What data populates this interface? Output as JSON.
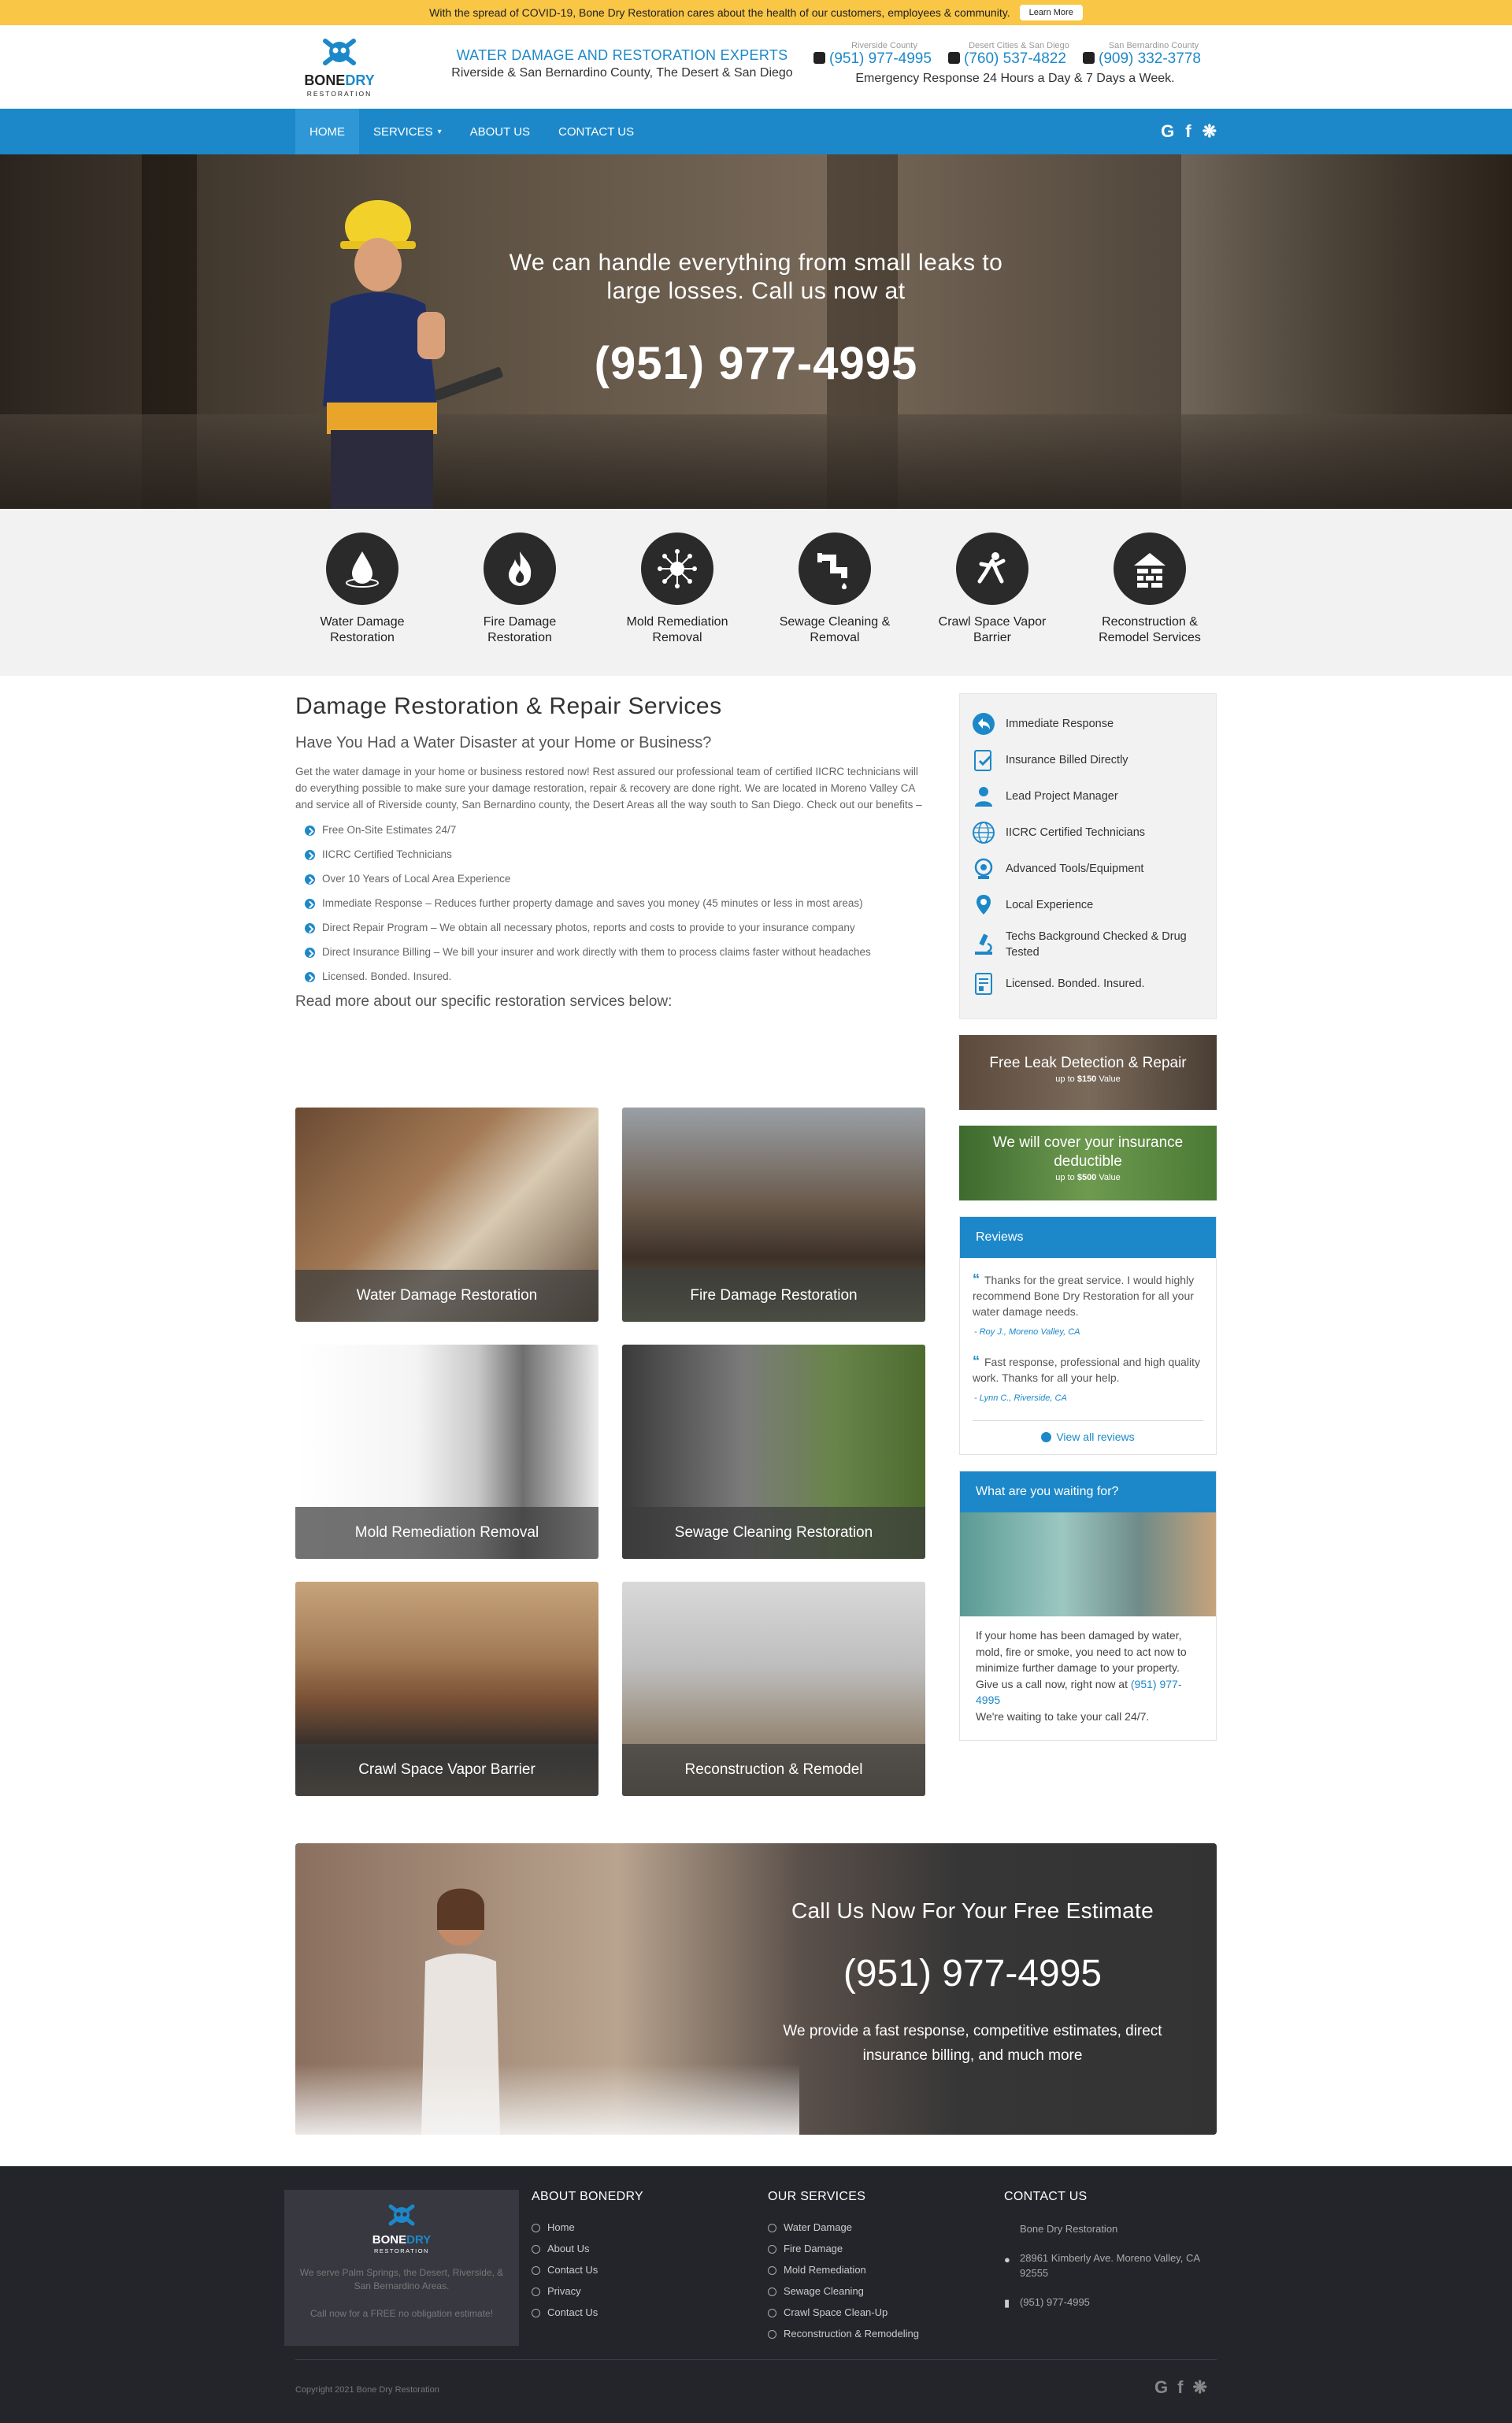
{
  "covid": {
    "text": "With the spread of COVID-19, Bone Dry Restoration cares about the health of our customers, employees & community.",
    "button": "Learn More"
  },
  "header": {
    "logo_brand_1": "BONE",
    "logo_brand_2": "DRY",
    "logo_sub": "RESTORATION",
    "tagline_1": "WATER DAMAGE AND RESTORATION EXPERTS",
    "tagline_2": "Riverside & San Bernardino County, The Desert & San Diego",
    "phones": [
      {
        "label": "Riverside County",
        "number": "(951) 977-4995"
      },
      {
        "label": "Desert Cities & San Diego",
        "number": "(760) 537-4822"
      },
      {
        "label": "San Bernardino County",
        "number": "(909) 332-3778"
      }
    ],
    "emergency": "Emergency Response 24 Hours a Day & 7 Days a Week."
  },
  "nav": {
    "items": [
      "Home",
      "Services",
      "About Us",
      "Contact Us"
    ],
    "social": [
      "google-icon",
      "facebook-icon",
      "yelp-icon"
    ]
  },
  "hero": {
    "line": "We can handle everything from small leaks to large losses. Call us now at",
    "phone": "(951) 977-4995"
  },
  "services": [
    {
      "icon": "water-drop-icon",
      "label": "Water Damage Restoration"
    },
    {
      "icon": "fire-icon",
      "label": "Fire Damage Restoration"
    },
    {
      "icon": "mold-icon",
      "label": "Mold Remediation Removal"
    },
    {
      "icon": "pipe-icon",
      "label": "Sewage Cleaning & Removal"
    },
    {
      "icon": "crawl-space-icon",
      "label": "Crawl Space Vapor Barrier"
    },
    {
      "icon": "house-brick-icon",
      "label": "Reconstruction & Remodel Services"
    }
  ],
  "main": {
    "title": "Damage Restoration & Repair Services",
    "subtitle": "Have You Had a Water Disaster at your Home or Business?",
    "intro": "Get the water damage in your home or business restored now! Rest assured our professional team of certified IICRC technicians will do everything possible to make sure your damage restoration, repair & recovery are done right. We are located in Moreno Valley CA and service all of Riverside county, San Bernardino county, the Desert Areas all the way south to San Diego. Check out our benefits –",
    "benefits": [
      "Free On-Site Estimates 24/7",
      "IICRC Certified Technicians",
      "Over 10 Years of Local Area Experience",
      "Immediate Response – Reduces further property damage and saves you money (45 minutes or less in most areas)",
      "Direct Repair Program – We obtain all necessary photos, reports and costs to provide to your insurance company",
      "Direct Insurance Billing – We bill your insurer and work directly with them to process claims faster without headaches",
      "Licensed. Bonded. Insured."
    ],
    "readmore": "Read more about our specific restoration services below:",
    "tiles": [
      "Water Damage Restoration",
      "Fire Damage Restoration",
      "Mold Remediation Removal",
      "Sewage Cleaning Restoration",
      "Crawl Space Vapor Barrier",
      "Reconstruction & Remodel"
    ]
  },
  "sidebar": {
    "features": [
      {
        "icon": "reply-arrow-icon",
        "label": "Immediate Response"
      },
      {
        "icon": "clipboard-check-icon",
        "label": "Insurance Billed Directly"
      },
      {
        "icon": "manager-icon",
        "label": "Lead Project Manager"
      },
      {
        "icon": "globe-icon",
        "label": "IICRC Certified Technicians"
      },
      {
        "icon": "tools-icon",
        "label": "Advanced Tools/Equipment"
      },
      {
        "icon": "location-pin-icon",
        "label": "Local Experience"
      },
      {
        "icon": "microscope-icon",
        "label": "Techs Background Checked & Drug Tested"
      },
      {
        "icon": "document-icon",
        "label": "Licensed. Bonded. Insured."
      }
    ],
    "promo1": {
      "title": "Free Leak Detection & Repair",
      "sub_pre": "up to ",
      "sub_val": "$150",
      "sub_post": " Value"
    },
    "promo2": {
      "title": "We will cover your insurance deductible",
      "sub_pre": "up to ",
      "sub_val": "$500",
      "sub_post": " Value"
    },
    "reviews": {
      "title": "Reviews",
      "items": [
        {
          "text": "Thanks for the great service. I would highly recommend Bone Dry Restoration for all your water damage needs.",
          "by": "- Roy J., Moreno Valley, CA"
        },
        {
          "text": "Fast response, professional and high quality work. Thanks for all your help.",
          "by": "- Lynn C., Riverside, CA"
        }
      ],
      "view_all": "View all reviews"
    },
    "waiting": {
      "title": "What are you waiting for?",
      "text": "If your home has been damaged by water, mold, fire or smoke, you need to act now to minimize further damage to your property. Give us a call now, right now at",
      "phone": "(951) 977-4995",
      "text2": "We're waiting to take your call 24/7."
    }
  },
  "cta": {
    "title": "Call Us Now For Your Free Estimate",
    "phone": "(951) 977-4995",
    "text": "We provide a fast response, competitive estimates, direct insurance billing, and much more"
  },
  "footer": {
    "box_text": "We serve Palm Springs, the Desert, Riverside, & San Bernardino Areas.",
    "box_cta": "Call now for a FREE no obligation estimate!",
    "about_title": "ABOUT BONEDRY",
    "about_links": [
      "Home",
      "About Us",
      "Contact Us",
      "Privacy",
      "Contact Us"
    ],
    "services_title": "OUR SERVICES",
    "services_links": [
      "Water Damage",
      "Fire Damage",
      "Mold Remediation",
      "Sewage Cleaning",
      "Crawl Space Clean-Up",
      "Reconstruction & Remodeling"
    ],
    "contact_title": "CONTACT US",
    "company": "Bone Dry Restoration",
    "address": "28961 Kimberly Ave. Moreno Valley, CA 92555",
    "phone": "(951) 977-4995",
    "copyright": "Copyright 2021 Bone Dry Restoration"
  },
  "colors": {
    "brand_blue": "#1d88c9",
    "covid_yellow": "#f9c645",
    "footer_bg": "#24242b"
  }
}
